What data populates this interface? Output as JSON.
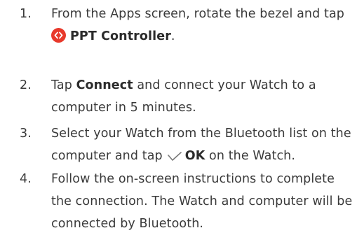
{
  "colors": {
    "text": "#3a3a3a",
    "app_icon": "#e8392b",
    "check_icon": "#7a7a7a"
  },
  "steps": [
    {
      "number": "1.",
      "line1": "From the Apps screen, rotate the bezel and tap",
      "app_icon": "ppt-controller-app-icon",
      "app_name": "PPT Controller",
      "tail": "."
    },
    {
      "number": "2.",
      "pre": "Tap ",
      "bold": "Connect",
      "post": " and connect your Watch to a",
      "line2": "computer in 5 minutes."
    },
    {
      "number": "3.",
      "line1": "Select your Watch from the Bluetooth list on the",
      "pre": "computer and tap",
      "check_icon": "check-icon",
      "bold": "OK",
      "post": " on the Watch."
    },
    {
      "number": "4.",
      "line1": "Follow the on-screen instructions to complete",
      "line2": "the connection. The Watch and computer will be",
      "line3": "connected by Bluetooth."
    }
  ]
}
